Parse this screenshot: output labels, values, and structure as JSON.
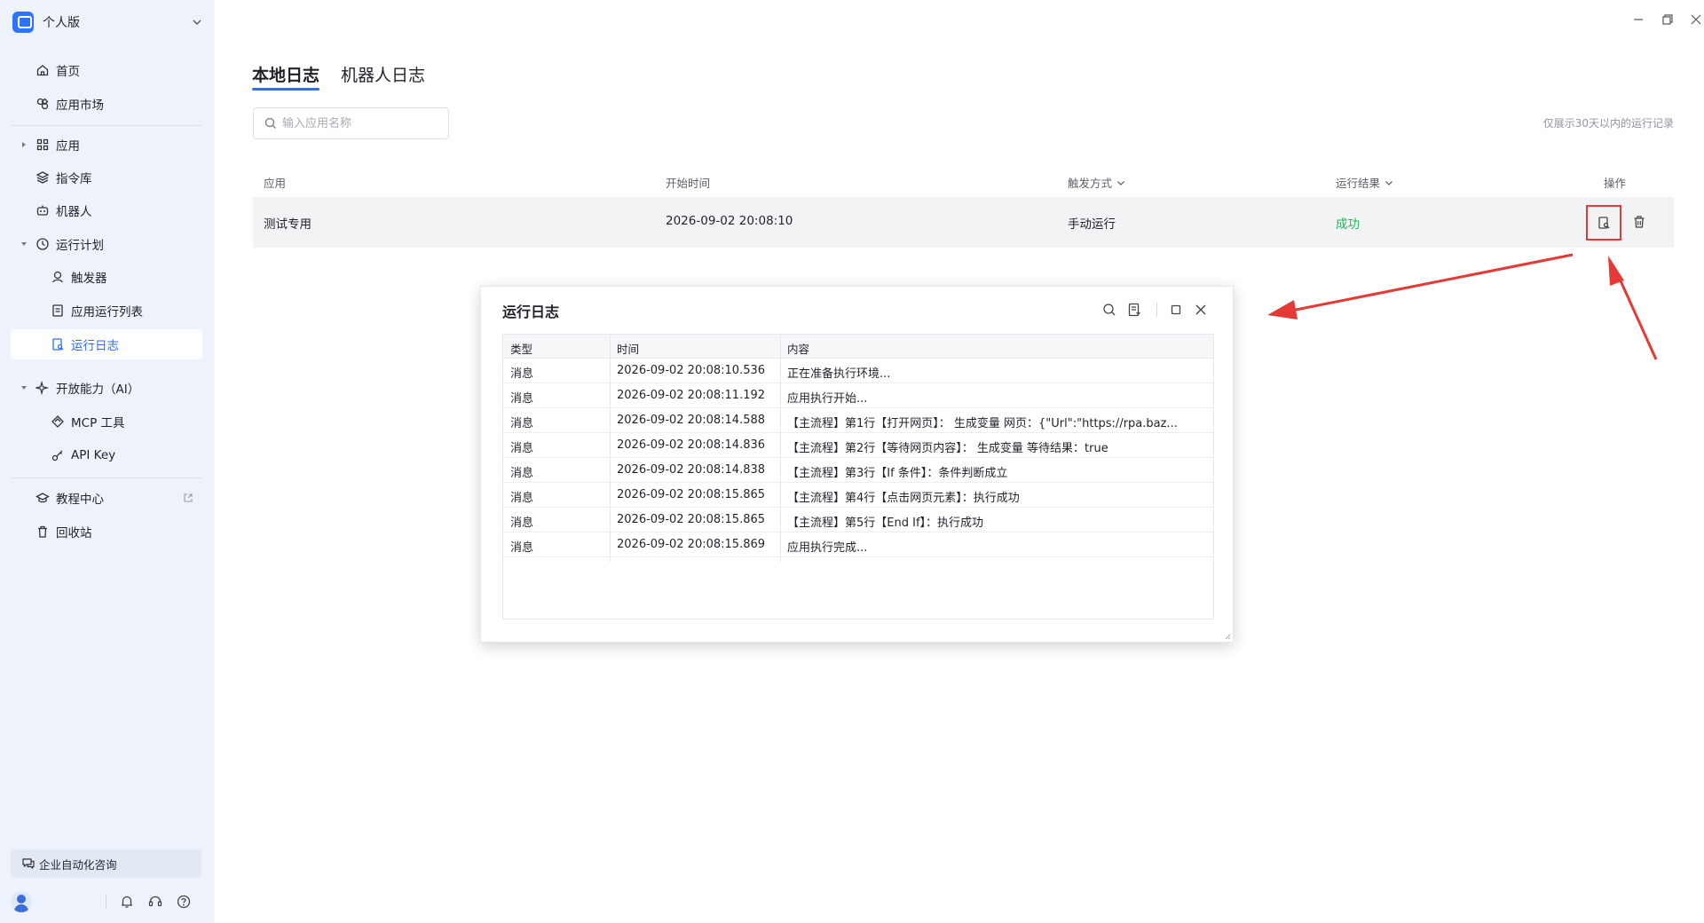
{
  "sidebar": {
    "workspace": "个人版",
    "items": [
      {
        "label": "首页"
      },
      {
        "label": "应用市场"
      },
      {
        "label": "应用"
      },
      {
        "label": "指令库"
      },
      {
        "label": "机器人"
      },
      {
        "label": "运行计划"
      },
      {
        "label": "触发器"
      },
      {
        "label": "应用运行列表"
      },
      {
        "label": "运行日志"
      },
      {
        "label": "开放能力（AI）"
      },
      {
        "label": "MCP 工具"
      },
      {
        "label": "API Key"
      },
      {
        "label": "教程中心"
      },
      {
        "label": "回收站"
      }
    ],
    "consult": "企业自动化咨询"
  },
  "tabs": [
    "本地日志",
    "机器人日志"
  ],
  "search": {
    "placeholder": "输入应用名称"
  },
  "hint": "仅展示30天以内的运行记录",
  "table": {
    "headers": [
      "应用",
      "开始时间",
      "触发方式",
      "运行结果",
      "操作"
    ],
    "rows": [
      {
        "app": "测试专用",
        "start": "2026-09-02 20:08:10",
        "trigger": "手动运行",
        "result": "成功"
      }
    ]
  },
  "dialog": {
    "title": "运行日志",
    "headers": [
      "类型",
      "时间",
      "内容"
    ],
    "rows": [
      {
        "type": "消息",
        "time": "2026-09-02 20:08:10.536",
        "content": "正在准备执行环境..."
      },
      {
        "type": "消息",
        "time": "2026-09-02 20:08:11.192",
        "content": "应用执行开始..."
      },
      {
        "type": "消息",
        "time": "2026-09-02 20:08:14.588",
        "content": "【主流程】第1行【打开网页】： 生成变量 网页：{\"Url\":\"https://rpa.baz..."
      },
      {
        "type": "消息",
        "time": "2026-09-02 20:08:14.836",
        "content": "【主流程】第2行【等待网页内容】： 生成变量 等待结果：true"
      },
      {
        "type": "消息",
        "time": "2026-09-02 20:08:14.838",
        "content": "【主流程】第3行【If 条件】：条件判断成立"
      },
      {
        "type": "消息",
        "time": "2026-09-02 20:08:15.865",
        "content": "【主流程】第4行【点击网页元素】：执行成功"
      },
      {
        "type": "消息",
        "time": "2026-09-02 20:08:15.865",
        "content": "【主流程】第5行【End If】：执行成功"
      },
      {
        "type": "消息",
        "time": "2026-09-02 20:08:15.869",
        "content": "应用执行完成..."
      }
    ]
  },
  "colors": {
    "accent": "#2f6bff",
    "success": "#1db954",
    "annotation": "#e53935"
  }
}
